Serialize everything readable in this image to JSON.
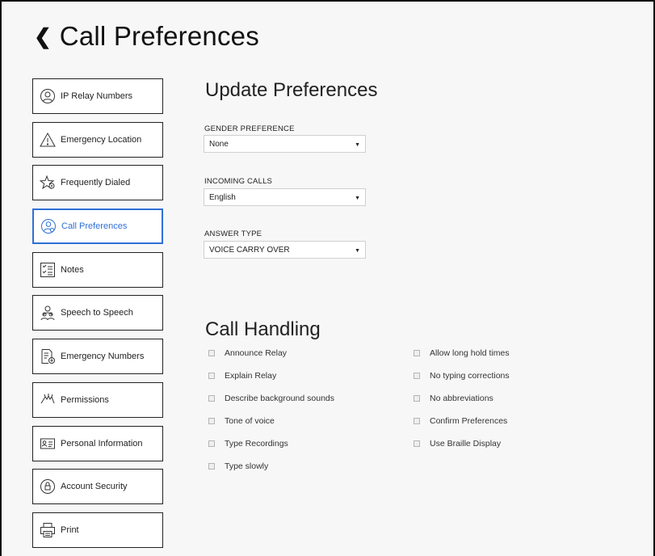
{
  "header": {
    "back_icon": "chevron-left-icon",
    "title": "Call Preferences"
  },
  "sidebar": {
    "items": [
      {
        "label": "IP Relay Numbers",
        "icon": "user-circle-icon"
      },
      {
        "label": "Emergency Location",
        "icon": "warning-triangle-icon"
      },
      {
        "label": "Frequently Dialed",
        "icon": "star-icon"
      },
      {
        "label": "Call Preferences",
        "icon": "user-gear-icon",
        "active": true
      },
      {
        "label": "Notes",
        "icon": "checklist-icon"
      },
      {
        "label": "Speech to Speech",
        "icon": "people-icon"
      },
      {
        "label": "Emergency Numbers",
        "icon": "document-plus-icon"
      },
      {
        "label": "Permissions",
        "icon": "hand-icon"
      },
      {
        "label": "Personal Information",
        "icon": "id-card-icon"
      },
      {
        "label": "Account Security",
        "icon": "lock-icon"
      },
      {
        "label": "Print",
        "icon": "printer-icon"
      }
    ]
  },
  "update": {
    "title": "Update Preferences",
    "fields": [
      {
        "label": "GENDER PREFERENCE",
        "value": "None"
      },
      {
        "label": "INCOMING CALLS",
        "value": "English"
      },
      {
        "label": "ANSWER TYPE",
        "value": "VOICE CARRY OVER"
      }
    ]
  },
  "handling": {
    "title": "Call Handling",
    "left": [
      "Announce Relay",
      "Explain Relay",
      "Describe background sounds",
      "Tone of voice",
      "Type Recordings",
      "Type slowly"
    ],
    "right": [
      "Allow long hold times",
      "No typing corrections",
      "No abbreviations",
      "Confirm Preferences",
      "Use Braille Display"
    ]
  },
  "colors": {
    "accent": "#2f6fd6",
    "background": "#f7f7f7",
    "border": "#222222"
  }
}
